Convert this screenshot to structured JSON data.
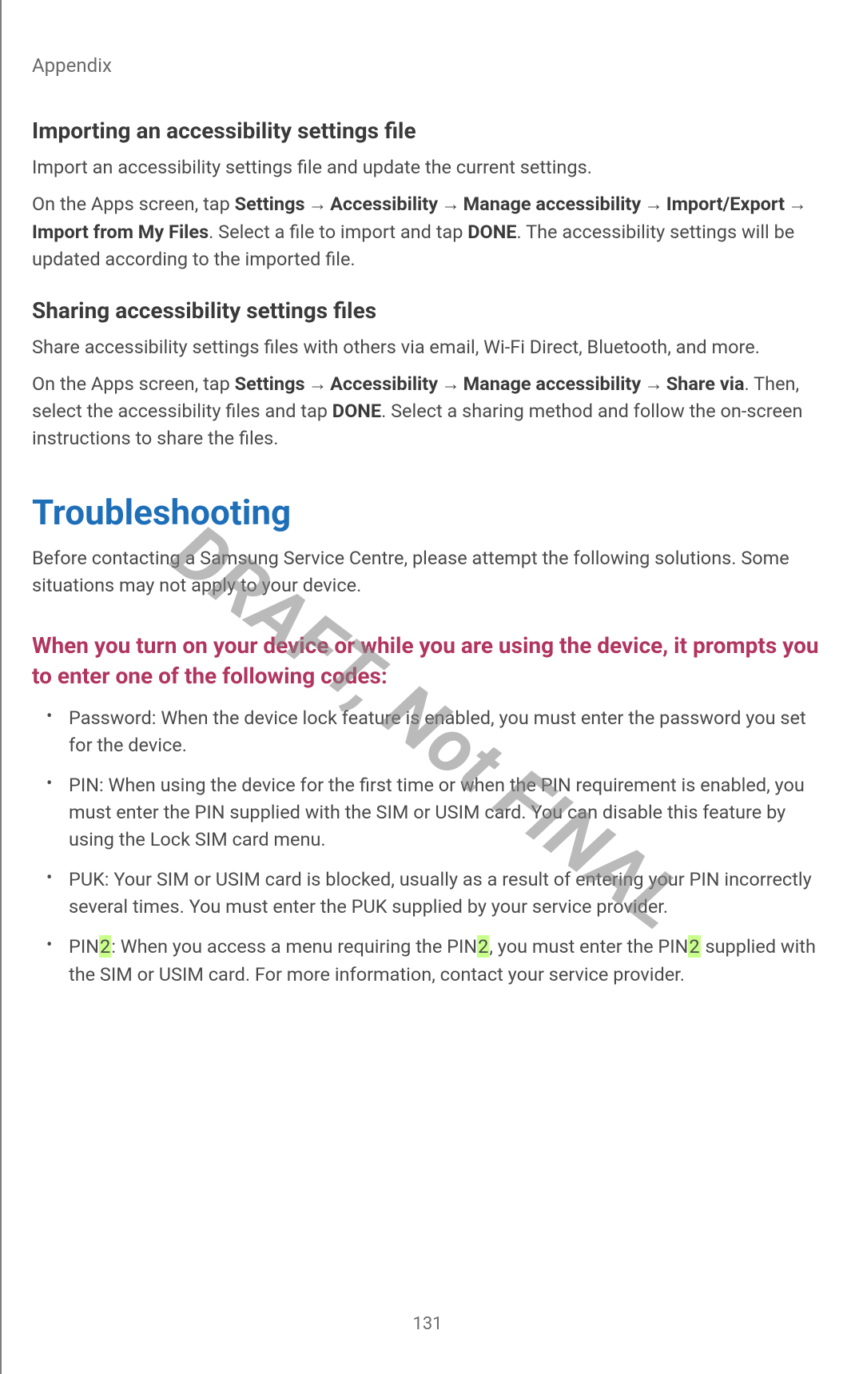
{
  "header": {
    "section": "Appendix"
  },
  "watermark": "DRAFT, Not FINAL",
  "page_number": "131",
  "sec1": {
    "title": "Importing an accessibility settings file",
    "p1": "Import an accessibility settings file and update the current settings.",
    "p2_pre": "On the Apps screen, tap ",
    "p2_b1": "Settings",
    "p2_b2": "Accessibility",
    "p2_b3": "Manage accessibility",
    "p2_b4": "Import/Export",
    "p2_b5": "Import from My Files",
    "p2_mid": ". Select a file to import and tap ",
    "p2_b6": "DONE",
    "p2_post": ". The accessibility settings will be updated according to the imported file."
  },
  "sec2": {
    "title": "Sharing accessibility settings files",
    "p1": "Share accessibility settings files with others via email, Wi-Fi Direct, Bluetooth, and more.",
    "p2_pre": "On the Apps screen, tap ",
    "p2_b1": "Settings",
    "p2_b2": "Accessibility",
    "p2_b3": "Manage accessibility",
    "p2_b4": "Share via",
    "p2_mid": ". Then, select the accessibility files and tap ",
    "p2_b5": "DONE",
    "p2_post": ". Select a sharing method and follow the on-screen instructions to share the files."
  },
  "troubleshooting": {
    "title": "Troubleshooting",
    "intro": "Before contacting a Samsung Service Centre, please attempt the following solutions. Some situations may not apply to your device.",
    "sub1_title": "When you turn on your device or while you are using the device, it prompts you to enter one of the following codes:",
    "bullets": {
      "b1": "Password: When the device lock feature is enabled, you must enter the password you set for the device.",
      "b2": "PIN: When using the device for the first time or when the PIN requirement is enabled, you must enter the PIN supplied with the SIM or USIM card. You can disable this feature by using the Lock SIM card menu.",
      "b3": "PUK: Your SIM or USIM card is blocked, usually as a result of entering your PIN incorrectly several times. You must enter the PUK supplied by your service provider.",
      "b4_a": "PIN",
      "b4_hl1": "2",
      "b4_b": ": When you access a menu requiring the PIN",
      "b4_hl2": "2",
      "b4_c": ", you must enter the PIN",
      "b4_hl3": "2",
      "b4_d": " supplied with the SIM or USIM card. For more information, contact your service provider."
    }
  }
}
